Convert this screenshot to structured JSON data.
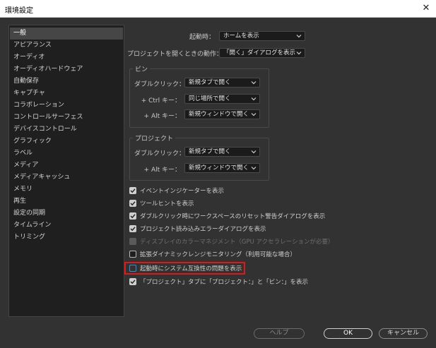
{
  "window": {
    "title": "環境設定",
    "close_icon": "✕"
  },
  "sidebar": {
    "items": [
      {
        "label": "一般",
        "selected": true
      },
      {
        "label": "アピアランス"
      },
      {
        "label": "オーディオ"
      },
      {
        "label": "オーディオハードウェア"
      },
      {
        "label": "自動保存"
      },
      {
        "label": "キャプチャ"
      },
      {
        "label": "コラボレーション"
      },
      {
        "label": "コントロールサーフェス"
      },
      {
        "label": "デバイスコントロール"
      },
      {
        "label": "グラフィック"
      },
      {
        "label": "ラベル"
      },
      {
        "label": "メディア"
      },
      {
        "label": "メディアキャッシュ"
      },
      {
        "label": "メモリ"
      },
      {
        "label": "再生"
      },
      {
        "label": "設定の同期"
      },
      {
        "label": "タイムライン"
      },
      {
        "label": "トリミング"
      }
    ]
  },
  "startup": {
    "label": "起動時：",
    "value": "ホームを表示"
  },
  "open_project": {
    "label": "プロジェクトを開くときの動作：",
    "value": "「開く」ダイアログを表示"
  },
  "bin_group": {
    "title": "ビン",
    "double_click": {
      "label": "ダブルクリック：",
      "value": "新規タブで開く"
    },
    "ctrl_key": {
      "label": "+ Ctrl キー：",
      "value": "同じ場所で開く"
    },
    "alt_key": {
      "label": "+ Alt キー：",
      "value": "新規ウィンドウで開く"
    }
  },
  "project_group": {
    "title": "プロジェクト",
    "double_click": {
      "label": "ダブルクリック：",
      "value": "新規タブで開く"
    },
    "alt_key": {
      "label": "+ Alt キー：",
      "value": "新規ウィンドウで開く"
    }
  },
  "checkboxes": [
    {
      "label": "イベントインジケーターを表示",
      "state": "checked"
    },
    {
      "label": "ツールヒントを表示",
      "state": "checked"
    },
    {
      "label": "ダブルクリック時にワークスペースのリセット警告ダイアログを表示",
      "state": "checked"
    },
    {
      "label": "プロジェクト読み込みエラーダイアログを表示",
      "state": "checked"
    },
    {
      "label": "ディスプレイのカラーマネジメント（GPU アクセラレーションが必要）",
      "state": "disabled"
    },
    {
      "label": "拡張ダイナミックレンジモニタリング（利用可能な場合）",
      "state": "unchecked"
    },
    {
      "label": "起動時にシステム互換性の問題を表示",
      "state": "unchecked-focused"
    },
    {
      "label": "「プロジェクト」タブに「プロジェクト：」と「ビン：」を表示",
      "state": "checked"
    }
  ],
  "buttons": {
    "help": "ヘルプ",
    "ok": "OK",
    "cancel": "キャンセル"
  },
  "colors": {
    "highlight_box": "#e01818",
    "focus_blue": "#2f8fdf",
    "panel_bg": "#323232"
  }
}
